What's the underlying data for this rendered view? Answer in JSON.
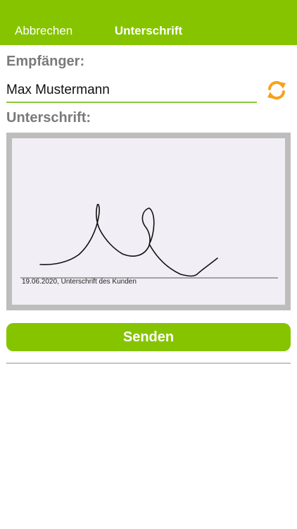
{
  "nav": {
    "cancel_label": "Abbrechen",
    "title": "Unterschrift"
  },
  "recipient": {
    "label": "Empfänger:",
    "value": "Max Mustermann"
  },
  "signature": {
    "label": "Unterschrift:",
    "caption": "19.06.2020, Unterschrift des Kunden"
  },
  "actions": {
    "send_label": "Senden"
  },
  "icons": {
    "refresh": "refresh-icon"
  },
  "colors": {
    "brand_green": "#86c400",
    "accent_orange": "#f7a21b",
    "label_gray": "#7a7a7a"
  }
}
